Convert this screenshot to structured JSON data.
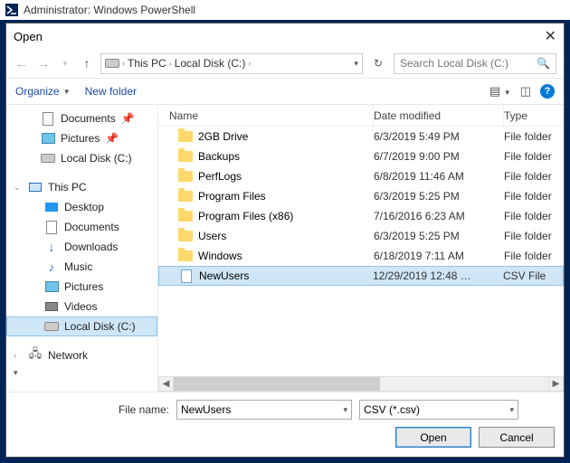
{
  "ps_title": "Administrator: Windows PowerShell",
  "dialog_title": "Open",
  "breadcrumb": {
    "pc": "This PC",
    "disk": "Local Disk (C:)"
  },
  "search_placeholder": "Search Local Disk (C:)",
  "toolbar": {
    "organize": "Organize",
    "new_folder": "New folder"
  },
  "columns": {
    "name": "Name",
    "date": "Date modified",
    "type": "Type"
  },
  "sidebar": {
    "quick": [
      {
        "label": "Documents"
      },
      {
        "label": "Pictures"
      },
      {
        "label": "Local Disk (C:)"
      }
    ],
    "thispc_label": "This PC",
    "thispc": [
      {
        "label": "Desktop"
      },
      {
        "label": "Documents"
      },
      {
        "label": "Downloads"
      },
      {
        "label": "Music"
      },
      {
        "label": "Pictures"
      },
      {
        "label": "Videos"
      },
      {
        "label": "Local Disk (C:)"
      }
    ],
    "network_label": "Network"
  },
  "files": [
    {
      "name": "2GB Drive",
      "date": "6/3/2019 5:49 PM",
      "type": "File folder",
      "kind": "folder"
    },
    {
      "name": "Backups",
      "date": "6/7/2019 9:00 PM",
      "type": "File folder",
      "kind": "folder"
    },
    {
      "name": "PerfLogs",
      "date": "6/8/2019 11:46 AM",
      "type": "File folder",
      "kind": "folder"
    },
    {
      "name": "Program Files",
      "date": "6/3/2019 5:25 PM",
      "type": "File folder",
      "kind": "folder"
    },
    {
      "name": "Program Files (x86)",
      "date": "7/16/2016 6:23 AM",
      "type": "File folder",
      "kind": "folder"
    },
    {
      "name": "Users",
      "date": "6/3/2019 5:25 PM",
      "type": "File folder",
      "kind": "folder"
    },
    {
      "name": "Windows",
      "date": "6/18/2019 7:11 AM",
      "type": "File folder",
      "kind": "folder"
    },
    {
      "name": "NewUsers",
      "date": "12/29/2019 12:48 …",
      "type": "CSV File",
      "kind": "csv",
      "selected": true
    }
  ],
  "filename_label": "File name:",
  "filename_value": "NewUsers",
  "filter_value": "CSV (*.csv)",
  "buttons": {
    "open": "Open",
    "cancel": "Cancel"
  }
}
